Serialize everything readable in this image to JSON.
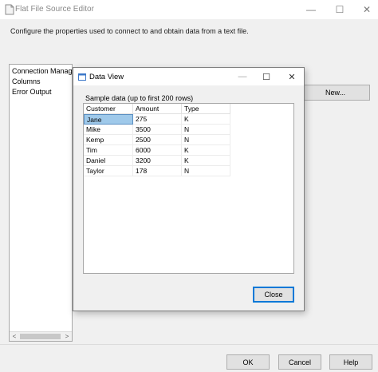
{
  "window": {
    "title": "Flat File Source Editor",
    "minimize": "—",
    "maximize": "☐",
    "close": "✕"
  },
  "instruction": "Configure the properties used to connect to and obtain data from a text file.",
  "nav": {
    "items": [
      {
        "label": "Connection Manager"
      },
      {
        "label": "Columns"
      },
      {
        "label": "Error Output"
      }
    ],
    "scroll_left": "<",
    "scroll_right": ">"
  },
  "new_button": "New...",
  "buttons": {
    "ok": "OK",
    "cancel": "Cancel",
    "help": "Help"
  },
  "dialog": {
    "title": "Data View",
    "minimize": "—",
    "maximize": "☐",
    "close": "✕",
    "sample_label": "Sample data (up to first 200 rows)",
    "columns": [
      "Customer",
      "Amount",
      "Type"
    ],
    "rows": [
      [
        "Jane",
        "275",
        "K"
      ],
      [
        "Mike",
        "3500",
        "N"
      ],
      [
        "Kemp",
        "2500",
        "N"
      ],
      [
        "Tim",
        "6000",
        "K"
      ],
      [
        "Daniel",
        "3200",
        "K"
      ],
      [
        "Taylor",
        "178",
        "N"
      ]
    ],
    "close_button": "Close"
  },
  "colors": {
    "selection": "#9fc9ea",
    "focus_border": "#0078d7"
  }
}
